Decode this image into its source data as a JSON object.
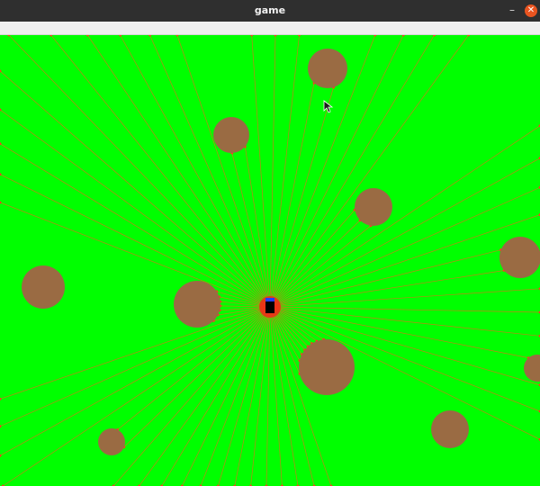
{
  "window": {
    "title": "game",
    "minimize_glyph": "–",
    "close_glyph": "✕",
    "close_color": "#e95420",
    "titlebar_color": "#2f2f2f"
  },
  "game": {
    "background_color": "#00ff00",
    "ray_color": "#ff5a1e",
    "obstacle_color": "#9a6b43",
    "obstacle_edge_color": "#ff3b1e",
    "player_color": "#000000",
    "player_marker_color": "#1f3dff",
    "glow_color": "#ff1a1a",
    "ray_count": 72,
    "obstacle_count": 12,
    "mouse_cursor_icon": "arrow-cursor-icon"
  }
}
